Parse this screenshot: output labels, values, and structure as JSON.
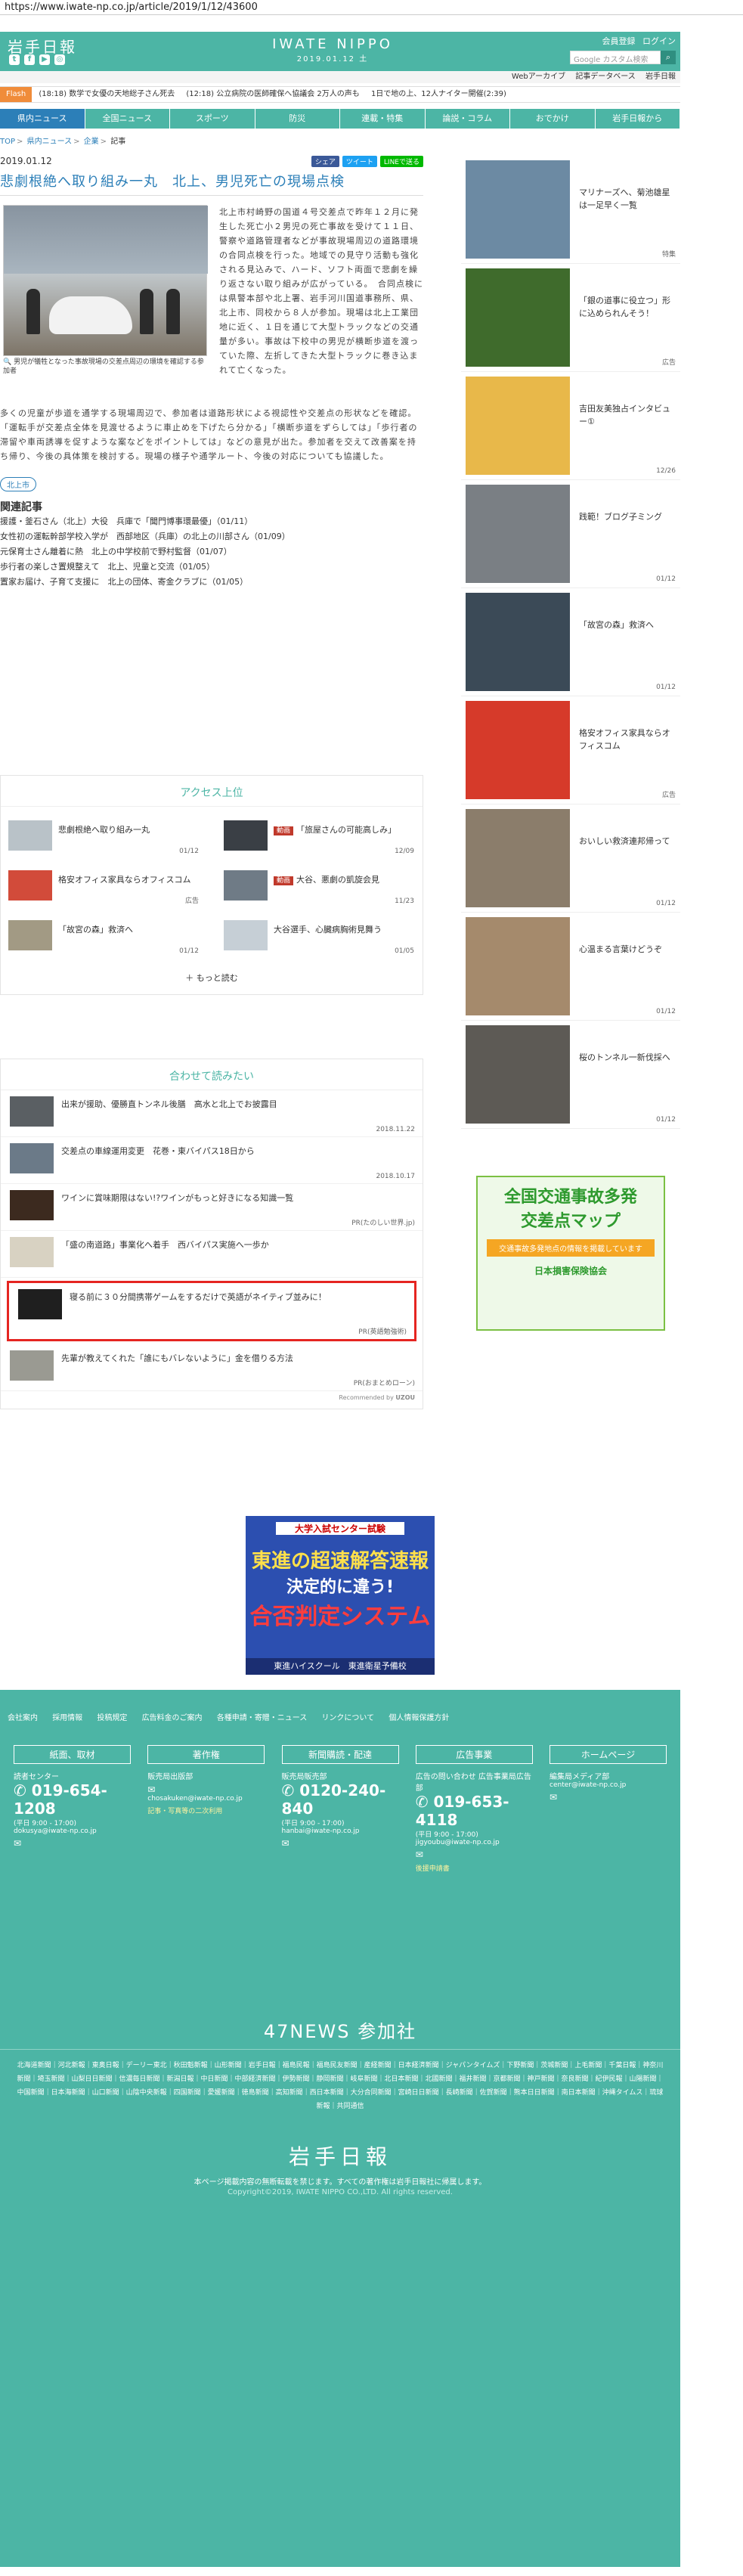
{
  "url": "https://www.iwate-np.co.jp/article/2019/1/12/43600",
  "header": {
    "logo": "岩手日報",
    "brand": "IWATE NIPPO",
    "date": "2019.01.12 土",
    "links": [
      "会員登録",
      "ログイン"
    ],
    "search_placeholder": "Google カスタム検索",
    "sub_links": [
      "Webアーカイブ",
      "記事データベース",
      "岩手日報"
    ]
  },
  "flash": {
    "tag": "Flash",
    "items": [
      "(18:18) 数学で女優の天地総子さん死去",
      "(12:18) 公立病院の医師確保へ協議会 2万人の声も",
      "1日で地の上、12人ナイター開催(2:39)"
    ]
  },
  "nav": [
    "県内ニュース",
    "全国ニュース",
    "スポーツ",
    "防災",
    "連載・特集",
    "論説・コラム",
    "おでかけ",
    "岩手日報から"
  ],
  "breadcrumb": [
    "TOP",
    "県内ニュース",
    "企業",
    "記事"
  ],
  "article": {
    "date": "2019.01.12",
    "share": [
      "シェア",
      "ツイート",
      "LINEで送る"
    ],
    "headline": "悲劇根絶へ取り組み一丸　北上、男児死亡の現場点検",
    "caption": "男児が犠牲となった事故現場の交差点周辺の環境を確認する参加者",
    "body_right": "北上市村崎野の国道４号交差点で昨年１２月に発生した死亡小２男児の死亡事故を受けて１１日、警察や道路管理者などが事故現場周辺の道路環境の合同点検を行った。地域での見守り活動も強化される見込みで、ハード、ソフト両面で悲劇を繰り返さない取り組みが広がっている。　合同点検には県警本部や北上署、岩手河川国道事務所、県、北上市、同校から８人が参加。現場は北上工業団地に近く、１日を通じて大型トラックなどの交通量が多い。事故は下校中の男児が横断歩道を渡っていた際、左折してきた大型トラックに巻き込まれて亡くなった。",
    "body_full": "多くの児童が歩道を通学する現場周辺で、参加者は道路形状による視認性や交差点の形状などを確認。「運転手が交差点全体を見渡せるように車止めを下げたら分かる」「横断歩道をずらしては」「歩行者の滞留や車両誘導を促すような案などをポイントしては」などの意見が出た。参加者を交えて改善案を持ち帰り、今後の具体策を検討する。現場の様子や通学ルート、今後の対応についても協議した。",
    "tag": "北上市",
    "related_title": "関連記事",
    "related": [
      "援護・釜石さん（北上）大役　兵庫で「聞門博事環最優」（01/11）",
      "女性初の運転幹部学校入学が　西部地区（兵庫）の北上の川部さん（01/09）",
      "元保育士さん離着に熱　北上の中学校前で野村監督（01/07）",
      "歩行者の楽しさ置規整えて　北上、児童と交流（01/05）",
      "置家お届け、子育て支援に　北上の団体、寄金クラブに（01/05）"
    ]
  },
  "access": {
    "title": "アクセス上位",
    "items": [
      {
        "title": "悲劇根絶へ取り組み一丸",
        "date": "01/12",
        "badge": ""
      },
      {
        "title": "「旅屋さんの可能高しみ」",
        "date": "12/09",
        "badge": "動画"
      },
      {
        "title": "格安オフィス家具ならオフィスコム",
        "date": "広告",
        "badge": ""
      },
      {
        "title": "大谷、悪劇の凱旋会見",
        "date": "11/23",
        "badge": "動画"
      },
      {
        "title": "「故宮の森」救済へ",
        "date": "01/12",
        "badge": ""
      },
      {
        "title": "大谷選手、心臓病胸術見舞う",
        "date": "01/05",
        "badge": ""
      }
    ],
    "more": "もっと読む"
  },
  "recommend": {
    "title": "合わせて読みたい",
    "items": [
      {
        "title": "出来が援助、優勝直トンネル後膳　高水と北上でお披露目",
        "meta": "2018.11.22"
      },
      {
        "title": "交差点の車線運用変更　花巻・東バイパス18日から",
        "meta": "2018.10.17"
      },
      {
        "title": "ワインに賞味期限はない!?ワインがもっと好きになる知識一覧",
        "meta": "PR(たのしい世界.jp)"
      },
      {
        "title": "「盛の南道路」事業化へ着手　西バイパス実施へ一歩か",
        "meta": ""
      },
      {
        "title": "寝る前に３０分間携帯ゲームをするだけで英語がネイティブ並みに！",
        "meta": "PR(英語勉強術)"
      },
      {
        "title": "先輩が教えてくれた「誰にもバレないように」金を借りる方法",
        "meta": "PR(おまとめローン)"
      }
    ],
    "powered": "Recommended by"
  },
  "center_ad": {
    "l1": "大学入試センター試験",
    "l2": "東進の超速解答速報",
    "l3": "決定的に違う!",
    "l4": "合否判定システム",
    "l5": "東進ハイスクール　東進衛星予備校"
  },
  "sidebar": [
    {
      "title": "マリナーズへ、菊池雄星は一足早く一覧",
      "date": "特集"
    },
    {
      "title": "「銀の道事に役立つ」形に込められんそう！",
      "date": "広告"
    },
    {
      "title": "吉田友美独占インタビュー①",
      "date": "12/26"
    },
    {
      "title": "践範！ブログ子ミング",
      "date": "01/12"
    },
    {
      "title": "「故宮の森」救済へ",
      "date": "01/12"
    },
    {
      "title": "格安オフィス家具ならオフィスコム",
      "date": "広告"
    },
    {
      "title": "おいしい救済連邦帰って",
      "date": "01/12"
    },
    {
      "title": "心温まる言葉けどうぞ",
      "date": "01/12"
    },
    {
      "title": "桜のトンネル一新伐採へ",
      "date": "01/12"
    }
  ],
  "side_banner": {
    "a": "全国交通事故多発",
    "b": "交差点マップ",
    "c": "交通事故多発地点の情報を掲載しています",
    "e": "日本損害保険協会"
  },
  "footer": {
    "links": [
      "会社案内",
      "採用情報",
      "投稿規定",
      "広告料金のご案内",
      "各種申請・寄贈・ニュース",
      "リンクについて",
      "個人情報保護方針"
    ],
    "cols": [
      {
        "head": "紙面、取材",
        "label": "読者センター",
        "tel": "019-654-1208",
        "hours": "(平日 9:00 - 17:00)",
        "mail": "dokusya@iwate-np.co.jp",
        "note": ""
      },
      {
        "head": "著作権",
        "label": "販売局出版部",
        "tel": "",
        "hours": "",
        "mail": "chosakuken@iwate-np.co.jp",
        "note": "記事・写真等の二次利用"
      },
      {
        "head": "新聞購読・配達",
        "label": "販売局販売部",
        "tel": "0120-240-840",
        "hours": "(平日 9:00 - 17:00)",
        "mail": "hanbai@iwate-np.co.jp",
        "note": ""
      },
      {
        "head": "広告事業",
        "label": "広告の問い合わせ 広告事業局広告部",
        "tel": "019-653-4118",
        "hours": "(平日 9:00 - 17:00)",
        "mail": "jigyoubu@iwate-np.co.jp",
        "note": "後援申請書"
      },
      {
        "head": "ホームページ",
        "label": "編集局メディア部",
        "tel": "",
        "hours": "",
        "mail": "center@iwate-np.co.jp",
        "note": ""
      }
    ],
    "news47": "47NEWS 参加社",
    "papers": "北海道新聞｜河北新報｜東奥日報｜デーリー東北｜秋田魁新報｜山形新聞｜岩手日報｜福島民報｜福島民友新聞｜産経新聞｜日本経済新聞｜ジャパンタイムズ｜下野新聞｜茨城新聞｜上毛新聞｜千葉日報｜神奈川新聞｜埼玉新聞｜山梨日日新聞｜信濃毎日新聞｜新潟日報｜中日新聞｜中部経済新聞｜伊勢新聞｜静岡新聞｜岐阜新聞｜北日本新聞｜北國新聞｜福井新聞｜京都新聞｜神戸新聞｜奈良新聞｜紀伊民報｜山陽新聞｜中国新聞｜日本海新聞｜山口新聞｜山陰中央新報｜四国新聞｜愛媛新聞｜徳島新聞｜高知新聞｜西日本新聞｜大分合同新聞｜宮崎日日新聞｜長崎新聞｜佐賀新聞｜熊本日日新聞｜南日本新聞｜沖縄タイムス｜琉球新報｜共同通信",
    "logo": "岩手日報",
    "note": "本ページ掲載内容の無断転載を禁じます。すべての著作権は岩手日報社に帰属します。",
    "copyright": "Copyright©2019, IWATE NIPPO CO.,LTD. All rights reserved."
  }
}
